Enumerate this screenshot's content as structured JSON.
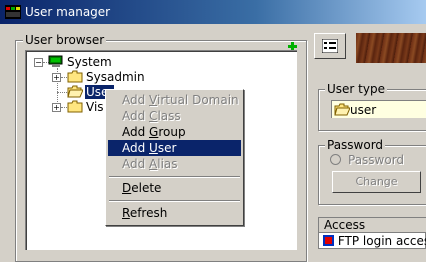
{
  "window": {
    "title": "User manager"
  },
  "user_browser": {
    "label": "User browser",
    "tree": {
      "root": "System",
      "children": [
        "Sysadmin",
        "User",
        "Vis"
      ]
    }
  },
  "context_menu": {
    "items": [
      {
        "label": "Add Virtual Domain",
        "enabled": false
      },
      {
        "label": "Add Class",
        "enabled": false
      },
      {
        "label": "Add Group",
        "enabled": true
      },
      {
        "label": "Add User",
        "enabled": true,
        "highlighted": true
      },
      {
        "label": "Add Alias",
        "enabled": false
      },
      {
        "label": "Delete",
        "enabled": true
      },
      {
        "label": "Refresh",
        "enabled": true
      }
    ]
  },
  "user_type": {
    "label": "User type",
    "value": "user"
  },
  "password": {
    "label": "Password",
    "radio_label": "Password",
    "change_label": "Change"
  },
  "access": {
    "header": "Access",
    "rows": [
      "FTP login access"
    ]
  },
  "colors": {
    "selection": "#0a246a",
    "face": "#d4d0c8",
    "field_bg": "#ffffe1"
  }
}
